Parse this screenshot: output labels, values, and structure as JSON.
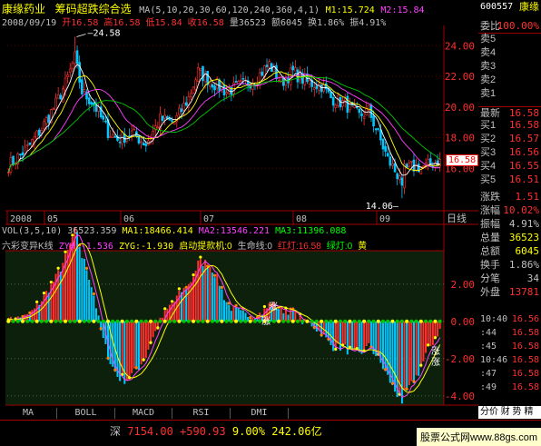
{
  "header": {
    "stock_name": "康缘药业",
    "indicator_title": "筹码超跌综合选",
    "ma_params": "MA(5,10,20,30,60,120,240,360,4,1)",
    "m1": "M1:15.724",
    "m2": "M2:15.84",
    "date": "2008/09/19",
    "open": "开16.58",
    "high": "高16.58",
    "low": "低15.84",
    "close": "收16.58",
    "volume": "量36523",
    "amount": "额6045",
    "turnover": "换1.86%",
    "amplitude": "振4.91%"
  },
  "price_axis": {
    "ticks": [
      "24.00",
      "22.00",
      "20.00",
      "18.00",
      "16.00"
    ],
    "current_tag": "16.58",
    "high_label": "24.58",
    "low_label": "14.06",
    "ylim": [
      13.6,
      25.2
    ]
  },
  "time_axis": {
    "labels": [
      "2008",
      "05",
      "06",
      "07",
      "08",
      "09"
    ],
    "period_label": "日线"
  },
  "volume_line": {
    "label": "VOL(3,5,10)",
    "value": "36523.359",
    "ma1": "MA1:18466.414",
    "ma2": "MA2:13546.221",
    "ma3": "MA3:11396.088"
  },
  "lower_indicator": {
    "name": "六彩变异K线",
    "zyh": "ZYH:-1.536",
    "zyg": "ZYG:-1.930",
    "start": "启动提款机:0",
    "life": "生命线:0",
    "red": "红灯:16.58",
    "green": "绿灯:0",
    "last": "黄",
    "ticks": [
      "2.00",
      "0.00",
      "-2.00",
      "-4.00"
    ],
    "ylim": [
      -4.4,
      3.6
    ],
    "mark_ma": "涨",
    "mark_zhang": "涨",
    "mark_right": "涨",
    "mark_right2": "涨"
  },
  "tabs": [
    "MA",
    "BOLL",
    "MACD",
    "RSI",
    "DMI"
  ],
  "sidebar": {
    "code": "600557",
    "name": "康缘",
    "weibi": "委比",
    "weibi_val": "100.00%",
    "asks": [
      {
        "label": "卖5",
        "value": ""
      },
      {
        "label": "卖4",
        "value": ""
      },
      {
        "label": "卖3",
        "value": ""
      },
      {
        "label": "卖2",
        "value": ""
      },
      {
        "label": "卖1",
        "value": ""
      }
    ],
    "last_label": "最新",
    "last_val": "16.58",
    "bids": [
      {
        "label": "买1",
        "value": "16.58"
      },
      {
        "label": "买2",
        "value": "16.57"
      },
      {
        "label": "买3",
        "value": "16.56"
      },
      {
        "label": "买4",
        "value": "16.55"
      },
      {
        "label": "买5",
        "value": "16.51"
      }
    ],
    "stats": [
      {
        "label": "涨跌",
        "value": "1.51"
      },
      {
        "label": "涨幅",
        "value": "10.02%"
      },
      {
        "label": "振幅",
        "value": "4.91%"
      },
      {
        "label": "总量",
        "value": "36523"
      },
      {
        "label": "总额",
        "value": "6045"
      },
      {
        "label": "换手",
        "value": "1.86%"
      },
      {
        "label": "分笔",
        "value": "34"
      },
      {
        "label": "外盘",
        "value": "13781"
      }
    ],
    "ticks": [
      {
        "time": "10:40",
        "price": "16.56"
      },
      {
        "time": ":44",
        "price": "16.58"
      },
      {
        "time": ":45",
        "price": "16.58"
      },
      {
        "time": "10:46",
        "price": "16.58"
      },
      {
        "time": ":47",
        "price": "16.58"
      },
      {
        "time": ":49",
        "price": "16.58"
      }
    ],
    "link_label": "分价 财 势 精"
  },
  "bottom": {
    "index_name": "深",
    "index_value": "7154.00",
    "index_change": "+590.93",
    "index_pct": "9.00%",
    "index_amount": "242.06亿",
    "watermark": "股票公式网www.88gs.com"
  },
  "colors": {
    "up": "#ff3030",
    "down": "#00c8ff",
    "yellow": "#ffff00",
    "magenta": "#ff40ff",
    "green": "#00c800",
    "white": "#ffffff",
    "panel": "#0a1a0a"
  }
}
